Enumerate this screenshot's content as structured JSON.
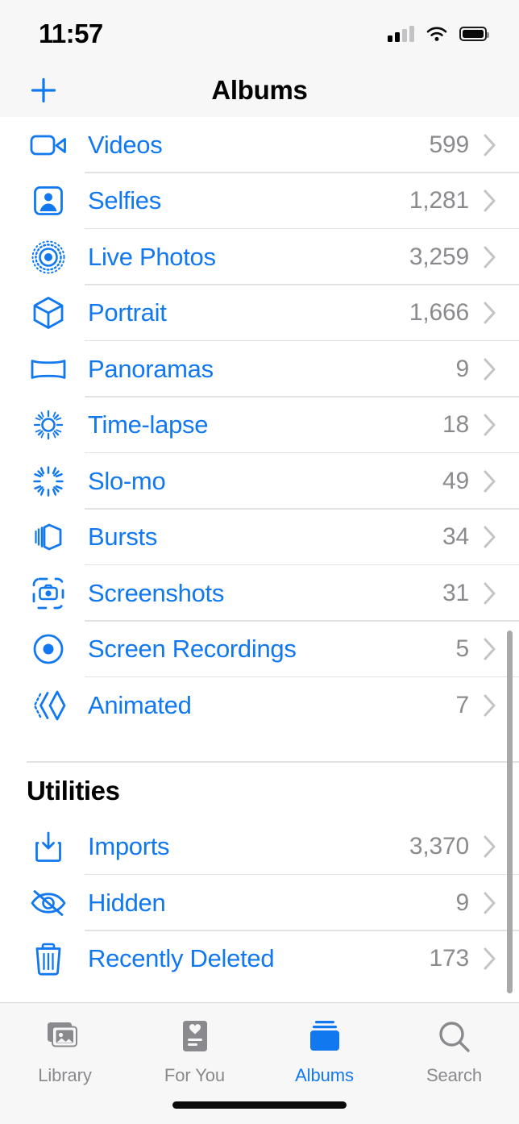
{
  "status_bar": {
    "time": "11:57",
    "cellular_icon": "cellular-signal-icon",
    "wifi_icon": "wifi-icon",
    "battery_icon": "battery-icon"
  },
  "nav_bar": {
    "title": "Albums",
    "add_button_icon": "plus-icon",
    "accent_color": "#1178f0"
  },
  "media_types": {
    "rows": [
      {
        "icon": "video-camera-icon",
        "label": "Videos",
        "count": "599"
      },
      {
        "icon": "person-portrait-icon",
        "label": "Selfies",
        "count": "1,281"
      },
      {
        "icon": "live-photo-icon",
        "label": "Live Photos",
        "count": "3,259"
      },
      {
        "icon": "cube-icon",
        "label": "Portrait",
        "count": "1,666"
      },
      {
        "icon": "panorama-icon",
        "label": "Panoramas",
        "count": "9"
      },
      {
        "icon": "timelapse-icon",
        "label": "Time-lapse",
        "count": "18"
      },
      {
        "icon": "slomo-icon",
        "label": "Slo-mo",
        "count": "49"
      },
      {
        "icon": "bursts-icon",
        "label": "Bursts",
        "count": "34"
      },
      {
        "icon": "screenshot-icon",
        "label": "Screenshots",
        "count": "31"
      },
      {
        "icon": "screen-recording-icon",
        "label": "Screen Recordings",
        "count": "5"
      },
      {
        "icon": "animated-icon",
        "label": "Animated",
        "count": "7"
      }
    ]
  },
  "utilities": {
    "header": "Utilities",
    "rows": [
      {
        "icon": "import-icon",
        "label": "Imports",
        "count": "3,370"
      },
      {
        "icon": "eye-slash-icon",
        "label": "Hidden",
        "count": "9"
      },
      {
        "icon": "trash-icon",
        "label": "Recently Deleted",
        "count": "173"
      }
    ]
  },
  "tab_bar": {
    "tabs": [
      {
        "icon": "photos-library-icon",
        "label": "Library",
        "active": false
      },
      {
        "icon": "for-you-icon",
        "label": "For You",
        "active": false
      },
      {
        "icon": "albums-icon",
        "label": "Albums",
        "active": true
      },
      {
        "icon": "magnifier-icon",
        "label": "Search",
        "active": false
      }
    ],
    "active_color": "#1178f0",
    "inactive_color": "#8a8a8e"
  },
  "colors": {
    "accent_blue": "#1178f0",
    "count_gray": "#8b8b8f",
    "chevron_gray": "#c4c4c6",
    "separator": "#e2e2e4",
    "chrome_bg": "#f7f7f7"
  }
}
